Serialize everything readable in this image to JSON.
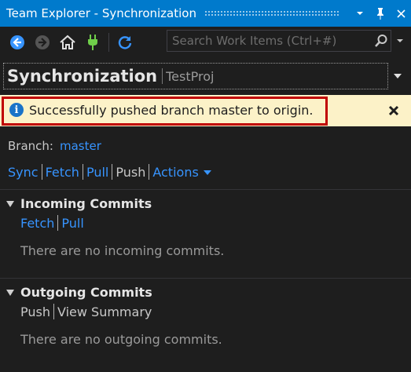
{
  "window": {
    "title": "Team Explorer - Synchronization",
    "buttons": {
      "dropdown": "▾",
      "pin": "📌",
      "close": "✕"
    }
  },
  "toolbar": {
    "icons": [
      "back-icon",
      "forward-icon",
      "home-icon",
      "connect-plug-icon",
      "refresh-icon"
    ],
    "search_placeholder": "Search Work Items (Ctrl+#)"
  },
  "page": {
    "title": "Synchronization",
    "project": "TestProj"
  },
  "notification": {
    "message": "Successfully pushed branch master to origin.",
    "close": "✕"
  },
  "branch": {
    "label": "Branch:",
    "value": "master"
  },
  "actions": {
    "sync": "Sync",
    "fetch": "Fetch",
    "pull": "Pull",
    "push": "Push",
    "actions": "Actions"
  },
  "incoming": {
    "title": "Incoming Commits",
    "fetch": "Fetch",
    "pull": "Pull",
    "empty": "There are no incoming commits."
  },
  "outgoing": {
    "title": "Outgoing Commits",
    "push": "Push",
    "view_summary": "View Summary",
    "empty": "There are no outgoing commits."
  },
  "colors": {
    "titlebar": "#007acc",
    "background": "#1e1e1e",
    "link": "#3794ff",
    "notification_bg": "#fcf2c8",
    "highlight_outline": "#c00000"
  }
}
